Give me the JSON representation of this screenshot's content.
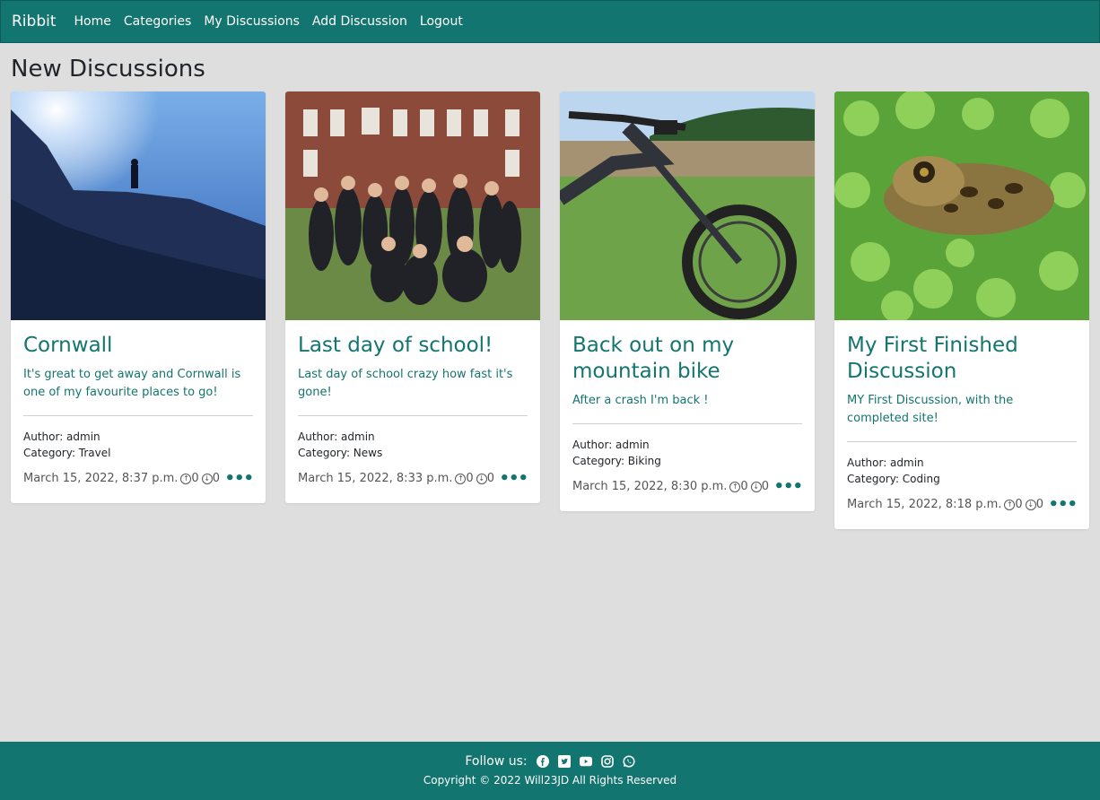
{
  "nav": {
    "brand": "Ribbit",
    "links": [
      "Home",
      "Categories",
      "My Discussions",
      "Add Discussion",
      "Logout"
    ]
  },
  "page": {
    "title": "New Discussions"
  },
  "cards": [
    {
      "title": "Cornwall",
      "text": "It's great to get away and Cornwall is one of my favourite places to go!",
      "author": "Author: admin",
      "category": "Category: Travel",
      "date": "March 15, 2022, 8:37 p.m.",
      "upvotes": "0",
      "downvotes": "0",
      "image": "silhouette-on-cliff"
    },
    {
      "title": "Last day of school!",
      "text": "Last day of school crazy how fast it's gone!",
      "author": "Author: admin",
      "category": "Category: News",
      "date": "March 15, 2022, 8:33 p.m.",
      "upvotes": "0",
      "downvotes": "0",
      "image": "group-photo"
    },
    {
      "title": "Back out on my mountain bike",
      "text": "After a crash I'm back !",
      "author": "Author: admin",
      "category": "Category: Biking",
      "date": "March 15, 2022, 8:30 p.m.",
      "upvotes": "0",
      "downvotes": "0",
      "image": "mountain-bike"
    },
    {
      "title": "My First Finished Discussion",
      "text": "MY First Discussion, with the completed site!",
      "author": "Author: admin",
      "category": "Category: Coding",
      "date": "March 15, 2022, 8:18 p.m.",
      "upvotes": "0",
      "downvotes": "0",
      "image": "frog-in-leaves"
    }
  ],
  "footer": {
    "follow": "Follow us:",
    "social_icons": [
      "facebook-icon",
      "twitter-icon",
      "youtube-icon",
      "instagram-icon",
      "whatsapp-icon"
    ],
    "copyright": "Copyright © 2022 Will23JD All Rights Reserved"
  },
  "colors": {
    "brand": "#137570",
    "background": "#dedede"
  }
}
